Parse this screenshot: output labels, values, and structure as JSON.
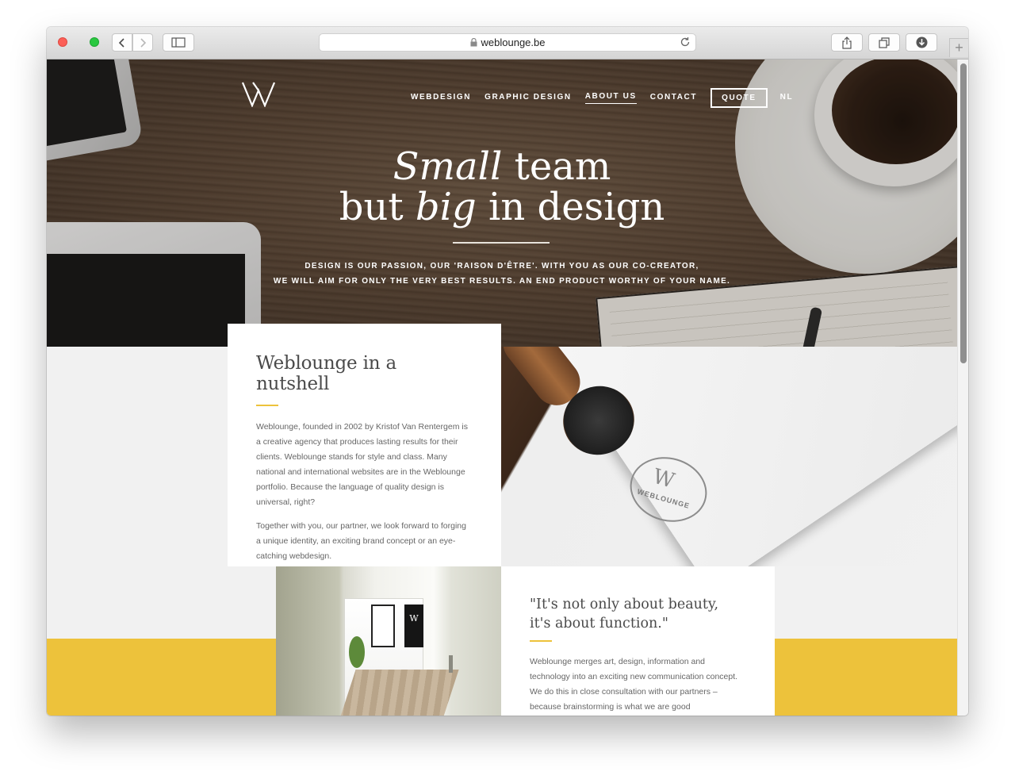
{
  "browser": {
    "url": "weblounge.be"
  },
  "nav": {
    "logo": "W",
    "items": [
      "WEBDESIGN",
      "GRAPHIC DESIGN",
      "ABOUT US",
      "CONTACT"
    ],
    "quote": "QUOTE",
    "lang": "NL"
  },
  "hero": {
    "line1_italic": "Small",
    "line1_rest": " team",
    "line2_pre": "but ",
    "line2_italic": "big",
    "line2_rest": " in design",
    "sub_line1": "DESIGN IS OUR PASSION, OUR 'RAISON D'ÊTRE'. WITH YOU AS OUR CO-CREATOR,",
    "sub_line2": "WE WILL AIM FOR ONLY THE VERY BEST RESULTS. AN END PRODUCT WORTHY OF YOUR NAME."
  },
  "nutshell": {
    "title": "Weblounge in a nutshell",
    "para1": "Weblounge, founded in 2002 by Kristof Van Rentergem is a creative agency that produces lasting results for their clients. Weblounge stands for style and class. Many national and international websites are in the Weblounge portfolio. Because the language of quality design is universal, right?",
    "para2": "Together with you, our partner, we look forward to forging a unique identity, an exciting brand concept or an eye-catching webdesign."
  },
  "stamp": {
    "text": "WEBLOUNGE"
  },
  "office": {
    "poster_letter": "W"
  },
  "function": {
    "title_line1": "\"It's not only about beauty,",
    "title_line2": "it's about function.\"",
    "para": "Weblounge merges art, design, information and technology into an exciting new communication concept. We do this in close consultation with our partners – because brainstorming is what we are good"
  },
  "colors": {
    "accent": "#edc23b",
    "text": "#4a4a4a"
  }
}
